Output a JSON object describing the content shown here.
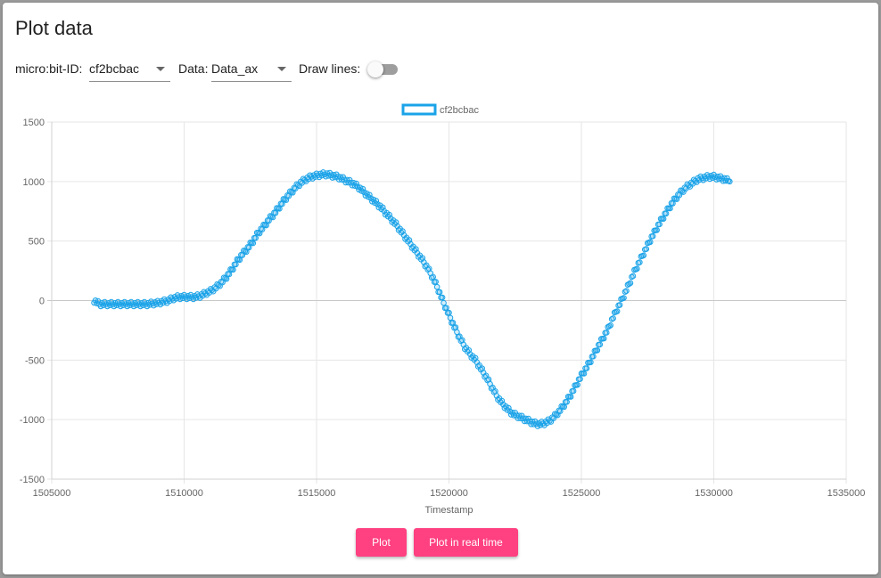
{
  "page": {
    "title": "Plot data"
  },
  "controls": {
    "device_label": "micro:bit-ID:",
    "device_value": "cf2bcbac",
    "data_label": "Data:",
    "data_value": "Data_ax",
    "lines_label": "Draw lines:",
    "lines_on": false
  },
  "buttons": {
    "plot": "Plot",
    "realtime": "Plot in real time"
  },
  "colors": {
    "series": "#1aa3e8",
    "accent": "#ff4081"
  },
  "chart_data": {
    "type": "scatter",
    "xlabel": "Timestamp",
    "ylabel": "",
    "title": "",
    "xlim": [
      1505000,
      1535000
    ],
    "ylim": [
      -1500,
      1500
    ],
    "xticks": [
      "1505000",
      "1510000",
      "1515000",
      "1520000",
      "1525000",
      "1530000",
      "1535000"
    ],
    "yticks": [
      "1500",
      "1000",
      "500",
      "0",
      "-500",
      "-1000",
      "-1500"
    ],
    "legend_position": "top",
    "grid": true,
    "series": [
      {
        "name": "cf2bcbac",
        "x": [
          1506600,
          1506800,
          1507000,
          1507200,
          1507400,
          1507600,
          1507800,
          1508000,
          1508200,
          1508400,
          1508600,
          1508800,
          1509000,
          1509200,
          1509400,
          1509600,
          1509800,
          1510000,
          1510200,
          1510400,
          1510600,
          1510800,
          1511000,
          1511200,
          1511400,
          1511600,
          1511800,
          1512000,
          1512200,
          1512400,
          1512600,
          1512800,
          1513000,
          1513200,
          1513400,
          1513600,
          1513800,
          1514000,
          1514200,
          1514400,
          1514600,
          1514800,
          1515000,
          1515200,
          1515400,
          1515600,
          1515800,
          1516000,
          1516200,
          1516400,
          1516600,
          1516800,
          1517000,
          1517200,
          1517400,
          1517600,
          1517800,
          1518000,
          1518200,
          1518400,
          1518600,
          1518800,
          1519000,
          1519200,
          1519400,
          1519600,
          1519800,
          1520000,
          1520200,
          1520400,
          1520600,
          1520800,
          1521000,
          1521200,
          1521400,
          1521600,
          1521800,
          1522000,
          1522200,
          1522400,
          1522600,
          1522800,
          1523000,
          1523200,
          1523400,
          1523600,
          1523800,
          1524000,
          1524200,
          1524400,
          1524600,
          1524800,
          1525000,
          1525200,
          1525400,
          1525600,
          1525800,
          1526000,
          1526200,
          1526400,
          1526600,
          1526800,
          1527000,
          1527200,
          1527400,
          1527600,
          1527800,
          1528000,
          1528200,
          1528400,
          1528600,
          1528800,
          1529000,
          1529200,
          1529400,
          1529600,
          1529800,
          1530000,
          1530200,
          1530400,
          1530600
        ],
        "y": [
          0,
          -30,
          -30,
          -30,
          -30,
          -30,
          -30,
          -30,
          -30,
          -30,
          -30,
          -25,
          -20,
          -10,
          0,
          20,
          30,
          30,
          30,
          30,
          40,
          60,
          80,
          110,
          150,
          200,
          260,
          330,
          390,
          440,
          500,
          570,
          620,
          680,
          730,
          790,
          850,
          900,
          950,
          990,
          1020,
          1040,
          1050,
          1060,
          1060,
          1050,
          1040,
          1020,
          1000,
          980,
          950,
          910,
          870,
          830,
          790,
          740,
          690,
          640,
          580,
          520,
          460,
          400,
          340,
          270,
          190,
          90,
          -20,
          -120,
          -220,
          -310,
          -390,
          -450,
          -500,
          -570,
          -640,
          -720,
          -800,
          -860,
          -910,
          -950,
          -970,
          -990,
          -1010,
          -1030,
          -1040,
          -1030,
          -1010,
          -970,
          -920,
          -860,
          -790,
          -710,
          -630,
          -560,
          -480,
          -400,
          -320,
          -240,
          -140,
          -50,
          40,
          140,
          240,
          330,
          420,
          510,
          590,
          670,
          740,
          810,
          870,
          920,
          960,
          990,
          1020,
          1030,
          1040,
          1040,
          1030,
          1020,
          1000
        ]
      }
    ]
  }
}
